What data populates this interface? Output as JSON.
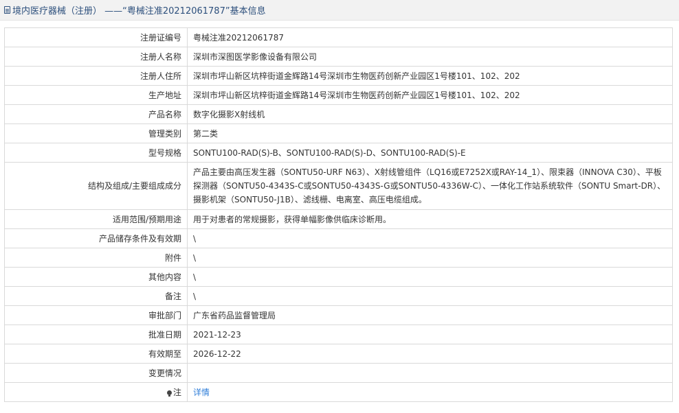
{
  "header": {
    "title": "境内医疗器械（注册） ——“粤械注准20212061787”基本信息"
  },
  "rows": [
    {
      "label": "注册证编号",
      "value": "粤械注准20212061787"
    },
    {
      "label": "注册人名称",
      "value": "深圳市深图医学影像设备有限公司"
    },
    {
      "label": "注册人住所",
      "value": "深圳市坪山新区坑梓街道金辉路14号深圳市生物医药创新产业园区1号楼101、102、202"
    },
    {
      "label": "生产地址",
      "value": "深圳市坪山新区坑梓街道金辉路14号深圳市生物医药创新产业园区1号楼101、102、202"
    },
    {
      "label": "产品名称",
      "value": "数字化摄影X射线机"
    },
    {
      "label": "管理类别",
      "value": "第二类"
    },
    {
      "label": "型号规格",
      "value": "SONTU100-RAD(S)-B、SONTU100-RAD(S)-D、SONTU100-RAD(S)-E"
    },
    {
      "label": "结构及组成/主要组成成分",
      "value": "产品主要由高压发生器（SONTU50-URF N63）、X射线管组件（LQ16或E7252X或RAY-14_1）、限束器（INNOVA C30）、平板探测器（SONTU50-4343S-C或SONTU50-4343S-G或SONTU50-4336W-C）、一体化工作站系统软件（SONTU Smart-DR）、摄影机架（SONTU50-J1B）、滤线栅、电离室、高压电缆组成。"
    },
    {
      "label": "适用范围/预期用途",
      "value": "用于对患者的常规摄影，获得单幅影像供临床诊断用。"
    },
    {
      "label": "产品储存条件及有效期",
      "value": "\\"
    },
    {
      "label": "附件",
      "value": "\\"
    },
    {
      "label": "其他内容",
      "value": "\\"
    },
    {
      "label": "备注",
      "value": "\\"
    },
    {
      "label": "审批部门",
      "value": "广东省药品监督管理局"
    },
    {
      "label": "批准日期",
      "value": "2021-12-23"
    },
    {
      "label": "有效期至",
      "value": "2026-12-22"
    },
    {
      "label": "变更情况",
      "value": ""
    }
  ],
  "note": {
    "label": "注",
    "link": "详情",
    "icon": "lightbulb-icon"
  }
}
